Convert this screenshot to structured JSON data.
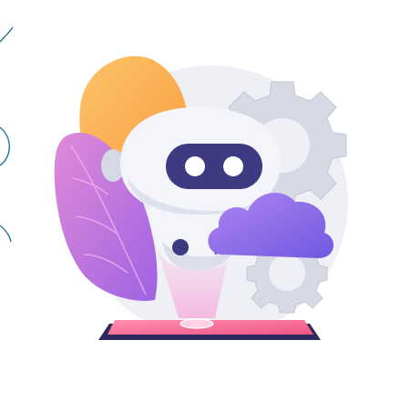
{
  "colors": {
    "background": "#ffffff",
    "backdrop_circle": "#eff0f6",
    "gear": "#d7d9e4",
    "gear_stroke": "#c3c6d4",
    "blob_orange": "#fba94d",
    "blob_orange_light": "#fdc46a",
    "leaf_pink": "#d77fd6",
    "leaf_purple": "#a86be0",
    "robot_body": "#f4f5fb",
    "robot_shadow": "#d6d8e6",
    "visor": "#3e3a82",
    "eye": "#ffffff",
    "cloud_top": "#b184f3",
    "cloud_bottom": "#6f59e0",
    "tablet_screen": "#f5698f",
    "tablet_frame": "#2d2a5e",
    "hologram": "#f7a6d8",
    "accent_line": "#2b6f9a"
  },
  "icons": [
    "robot-icon",
    "cloud-icon",
    "gear-icon",
    "tablet-icon"
  ]
}
